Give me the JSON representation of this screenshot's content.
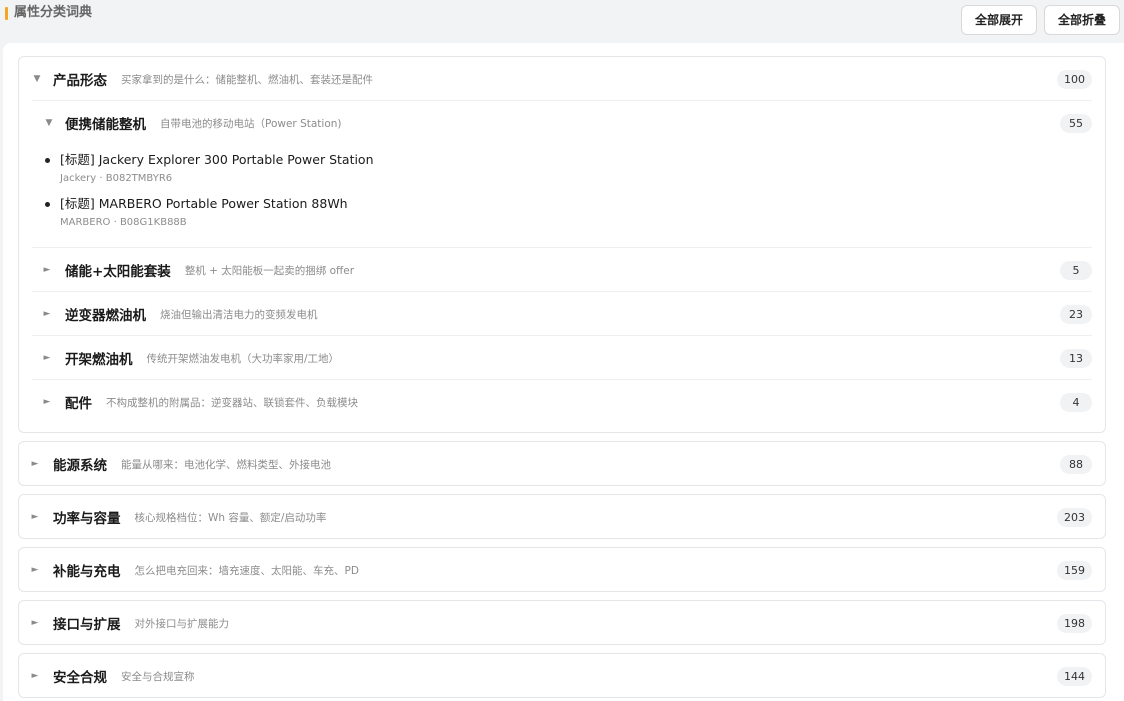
{
  "header": {
    "title": "属性分类词典",
    "expand_all_label": "全部展开",
    "collapse_all_label": "全部折叠"
  },
  "icons": {
    "expanded": "▼",
    "collapsed": "►"
  },
  "colors": {
    "accent": "#f5a623"
  },
  "groups": [
    {
      "name": "产品形态",
      "desc": "买家拿到的是什么：储能整机、燃油机、套装还是配件",
      "count": "100",
      "expanded": true,
      "children": [
        {
          "name": "便携储能整机",
          "desc": "自带电池的移动电站（Power Station)",
          "count": "55",
          "expanded": true,
          "items": [
            {
              "title": "[标题] Jackery Explorer 300 Portable Power Station",
              "meta": "Jackery · B082TMBYR6"
            },
            {
              "title": "[标题] MARBERO Portable Power Station 88Wh",
              "meta": "MARBERO · B08G1KB88B"
            }
          ]
        },
        {
          "name": "储能+太阳能套装",
          "desc": "整机 + 太阳能板一起卖的捆绑 offer",
          "count": "5",
          "expanded": false
        },
        {
          "name": "逆变器燃油机",
          "desc": "烧油但输出清洁电力的变频发电机",
          "count": "23",
          "expanded": false
        },
        {
          "name": "开架燃油机",
          "desc": "传统开架燃油发电机（大功率家用/工地）",
          "count": "13",
          "expanded": false
        },
        {
          "name": "配件",
          "desc": "不构成整机的附属品：逆变器站、联锁套件、负载模块",
          "count": "4",
          "expanded": false
        }
      ]
    },
    {
      "name": "能源系统",
      "desc": "能量从哪来：电池化学、燃料类型、外接电池",
      "count": "88",
      "expanded": false
    },
    {
      "name": "功率与容量",
      "desc": "核心规格档位：Wh 容量、额定/启动功率",
      "count": "203",
      "expanded": false
    },
    {
      "name": "补能与充电",
      "desc": "怎么把电充回来：墙充速度、太阳能、车充、PD",
      "count": "159",
      "expanded": false
    },
    {
      "name": "接口与扩展",
      "desc": "对外接口与扩展能力",
      "count": "198",
      "expanded": false
    },
    {
      "name": "安全合规",
      "desc": "安全与合规宣称",
      "count": "144",
      "expanded": false
    }
  ]
}
